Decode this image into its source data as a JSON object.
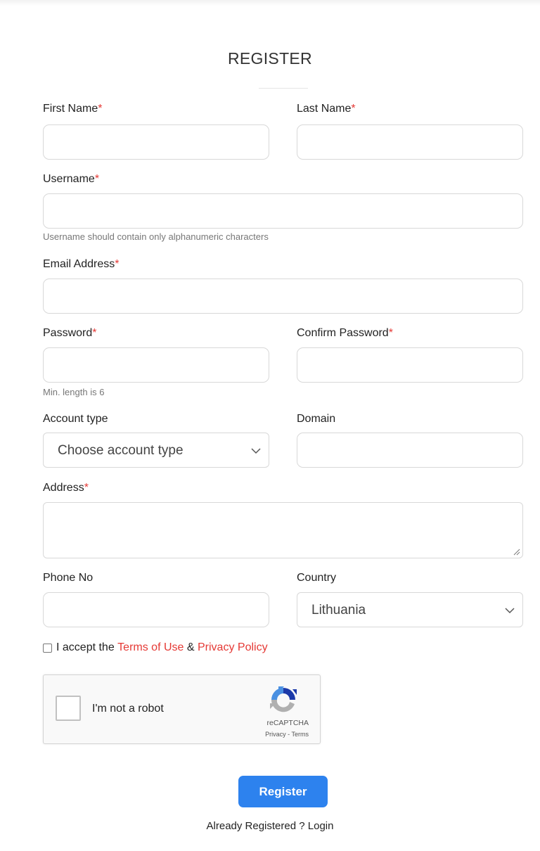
{
  "page": {
    "title": "REGISTER"
  },
  "form": {
    "first_name": {
      "label": "First Name",
      "required_mark": "*",
      "value": ""
    },
    "last_name": {
      "label": "Last Name",
      "required_mark": "*",
      "value": ""
    },
    "username": {
      "label": "Username",
      "required_mark": "*",
      "value": "",
      "hint": "Username should contain only alphanumeric characters"
    },
    "email": {
      "label": "Email Address",
      "required_mark": "*",
      "value": ""
    },
    "password": {
      "label": "Password",
      "required_mark": "*",
      "value": "",
      "hint": "Min. length is 6"
    },
    "confirm_password": {
      "label": "Confirm Password",
      "required_mark": "*",
      "value": ""
    },
    "account_type": {
      "label": "Account type",
      "selected": "Choose account type",
      "icon": "chevron-down-icon"
    },
    "domain": {
      "label": "Domain",
      "value": ""
    },
    "address": {
      "label": "Address",
      "required_mark": "*",
      "value": ""
    },
    "phone": {
      "label": "Phone No",
      "value": ""
    },
    "country": {
      "label": "Country",
      "selected": "Lithuania",
      "icon": "chevron-down-icon"
    },
    "terms": {
      "prefix": "I accept the",
      "terms_link": "Terms of Use",
      "ampersand": "&",
      "privacy_link": "Privacy Policy",
      "checked": false
    }
  },
  "recaptcha": {
    "label": "I'm not a robot",
    "brand": "reCAPTCHA",
    "privacy": "Privacy",
    "separator": "-",
    "terms": "Terms"
  },
  "actions": {
    "register_label": "Register",
    "login_prefix": "Already Registered ?",
    "login_link": "Login"
  },
  "colors": {
    "accent": "#2d82ee",
    "required": "#e53935",
    "link": "#e53935"
  }
}
